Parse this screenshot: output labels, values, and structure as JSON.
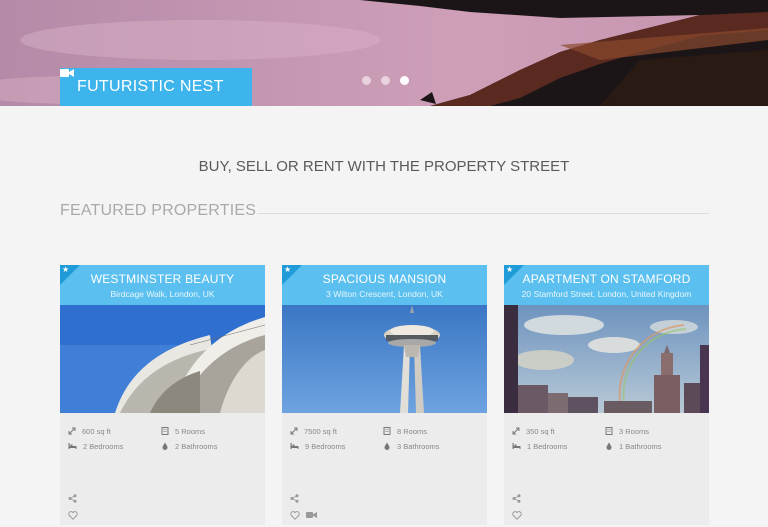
{
  "hero": {
    "label": "FUTURISTIC NEST",
    "camera_icon": "video-camera-icon",
    "slides": 3,
    "active_slide": 3
  },
  "tagline": "BUY, SELL OR RENT WITH THE PROPERTY STREET",
  "section": {
    "title": "FEATURED PROPERTIES"
  },
  "properties": [
    {
      "title": "WESTMINSTER BEAUTY",
      "address": "Birdcage Walk, London, UK",
      "area": "600 sq ft",
      "rooms": "5 Rooms",
      "bedrooms": "2 Bedrooms",
      "bathrooms": "2 Bathrooms",
      "has_video": false
    },
    {
      "title": "SPACIOUS MANSION",
      "address": "3 Wilton Crescent, London, UK",
      "area": "7500 sq ft",
      "rooms": "8 Rooms",
      "bedrooms": "9 Bedrooms",
      "bathrooms": "3 Bathrooms",
      "has_video": true
    },
    {
      "title": "APARTMENT ON STAMFORD",
      "address": "20 Stamford Street, London, United Kingdom",
      "area": "350 sq ft",
      "rooms": "3 Rooms",
      "bedrooms": "1 Bedrooms",
      "bathrooms": "1 Bathrooms",
      "has_video": false
    }
  ],
  "colors": {
    "accent": "#3db4ec",
    "card_header": "#5bc0ef",
    "ribbon": "#1f9bd7"
  }
}
